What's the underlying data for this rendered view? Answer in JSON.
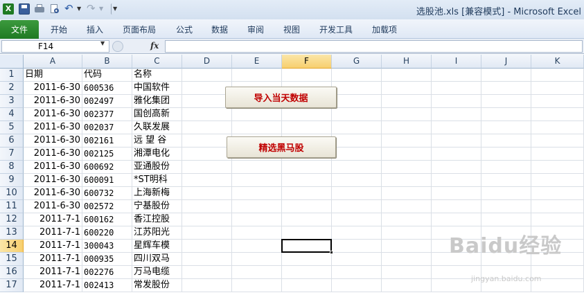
{
  "window": {
    "title": "选股池.xls  [兼容模式]  -  Microsoft Excel"
  },
  "quick_access": {
    "icons": [
      "excel-icon",
      "save-icon",
      "print-icon",
      "print-preview-icon",
      "undo-icon",
      "redo-icon",
      "customize-icon"
    ]
  },
  "ribbon": {
    "file_label": "文件",
    "tabs": [
      "开始",
      "插入",
      "页面布局",
      "公式",
      "数据",
      "审阅",
      "视图",
      "开发工具",
      "加载项"
    ]
  },
  "formula_bar": {
    "name_box": "F14",
    "fx_label": "fx",
    "formula": ""
  },
  "sheet": {
    "columns": [
      "A",
      "B",
      "C",
      "D",
      "E",
      "F",
      "G",
      "H",
      "I",
      "J",
      "K"
    ],
    "selected_column": "F",
    "selected_row": "14",
    "headers": [
      "日期",
      "代码",
      "名称"
    ],
    "rows": [
      {
        "num": "2",
        "date": "2011-6-30",
        "code": "600536",
        "name": "中国软件"
      },
      {
        "num": "3",
        "date": "2011-6-30",
        "code": "002497",
        "name": "雅化集团"
      },
      {
        "num": "4",
        "date": "2011-6-30",
        "code": "002377",
        "name": "国创高新"
      },
      {
        "num": "5",
        "date": "2011-6-30",
        "code": "002037",
        "name": "久联发展"
      },
      {
        "num": "6",
        "date": "2011-6-30",
        "code": "002161",
        "name": "远 望 谷"
      },
      {
        "num": "7",
        "date": "2011-6-30",
        "code": "002125",
        "name": "湘潭电化"
      },
      {
        "num": "8",
        "date": "2011-6-30",
        "code": "600692",
        "name": "亚通股份"
      },
      {
        "num": "9",
        "date": "2011-6-30",
        "code": "600091",
        "name": "*ST明科"
      },
      {
        "num": "10",
        "date": "2011-6-30",
        "code": "600732",
        "name": "上海新梅"
      },
      {
        "num": "11",
        "date": "2011-6-30",
        "code": "002572",
        "name": "宁基股份"
      },
      {
        "num": "12",
        "date": "2011-7-1",
        "code": "600162",
        "name": "香江控股"
      },
      {
        "num": "13",
        "date": "2011-7-1",
        "code": "600220",
        "name": "江苏阳光"
      },
      {
        "num": "14",
        "date": "2011-7-1",
        "code": "300043",
        "name": "星辉车模"
      },
      {
        "num": "15",
        "date": "2011-7-1",
        "code": "000935",
        "name": "四川双马"
      },
      {
        "num": "16",
        "date": "2011-7-1",
        "code": "002276",
        "name": "万马电缆"
      },
      {
        "num": "17",
        "date": "2011-7-1",
        "code": "002413",
        "name": "常发股份"
      }
    ]
  },
  "buttons": {
    "import_today": "导入当天数据",
    "select_dark_horse": "精选黑马股"
  },
  "watermark": {
    "main": "Baidu经验",
    "sub": "jingyan.baidu.com"
  }
}
